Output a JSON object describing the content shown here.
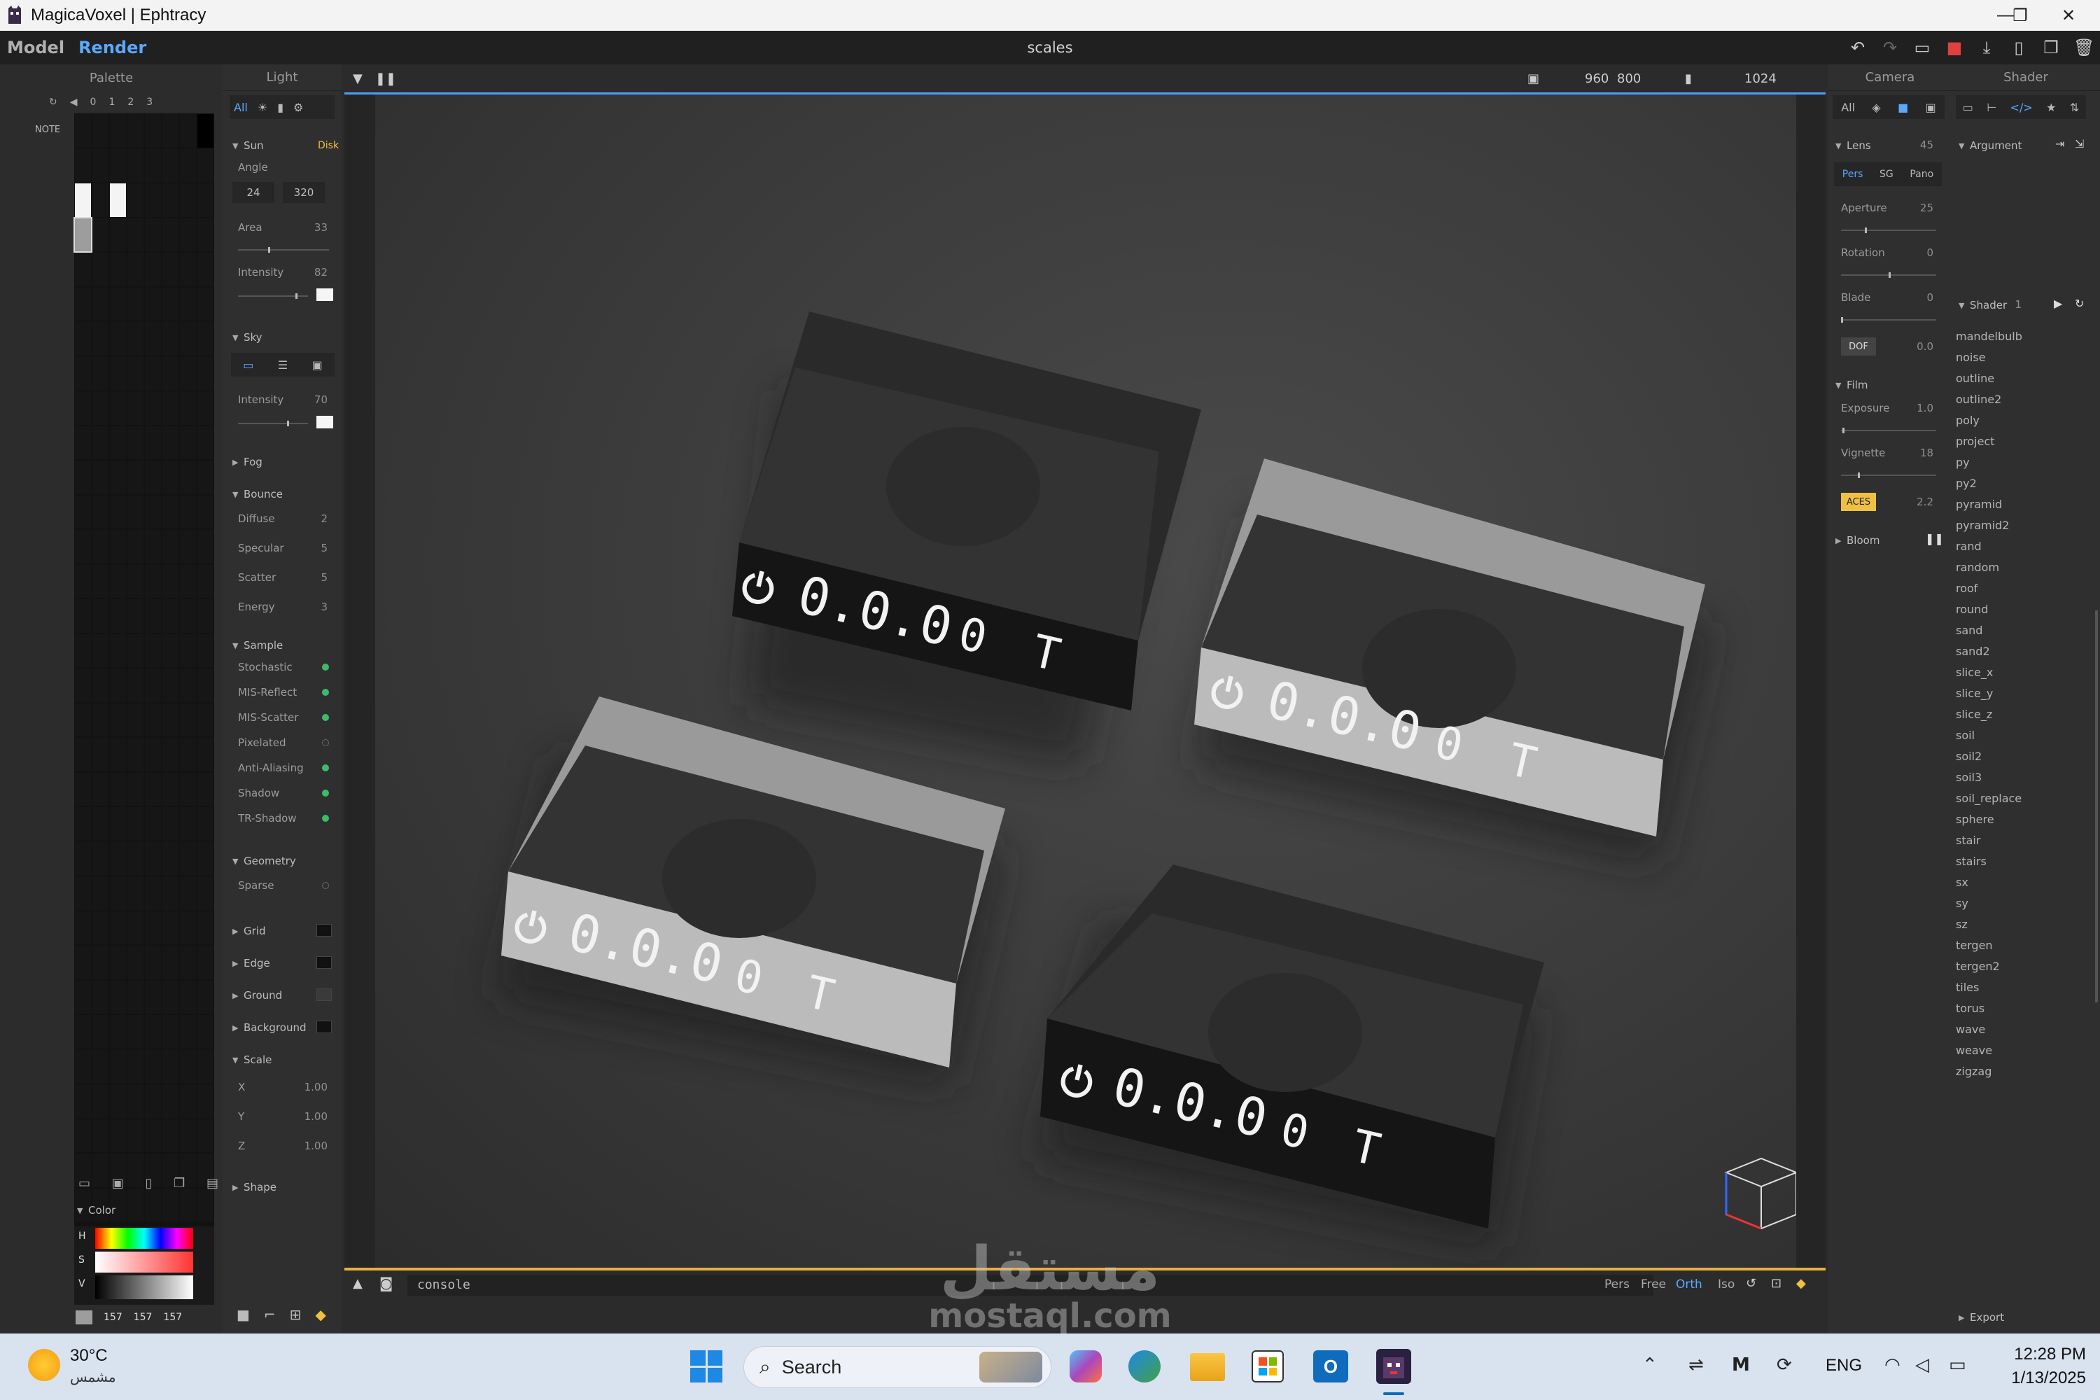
{
  "window": {
    "title": "MagicaVoxel | Ephtracy",
    "min": "—",
    "max": "❐",
    "close": "✕"
  },
  "menu": {
    "model": "Model",
    "render": "Render",
    "document": "scales"
  },
  "palette": {
    "title": "Palette",
    "pages": [
      "0",
      "1",
      "2",
      "3"
    ],
    "note": "NOTE",
    "color_title": "Color",
    "h": "H",
    "s": "S",
    "v": "V",
    "rgb": [
      "157",
      "157",
      "157"
    ]
  },
  "light": {
    "title": "Light",
    "all": "All",
    "sun": "Sun",
    "disk": "Disk",
    "angle": "Angle",
    "angle_a": "24",
    "angle_b": "320",
    "area": "Area",
    "area_v": "33",
    "intensity": "Intensity",
    "intensity_v": "82",
    "sky": "Sky",
    "sky_intensity": "Intensity",
    "sky_intensity_v": "70",
    "fog": "Fog",
    "bounce": "Bounce",
    "diffuse": "Diffuse",
    "diffuse_v": "2",
    "specular": "Specular",
    "specular_v": "5",
    "scatter": "Scatter",
    "scatter_v": "5",
    "energy": "Energy",
    "energy_v": "3",
    "sample": "Sample",
    "samples": [
      "Stochastic",
      "MIS-Reflect",
      "MIS-Scatter",
      "Pixelated",
      "Anti-Aliasing",
      "Shadow",
      "TR-Shadow"
    ],
    "sample_on": [
      true,
      true,
      true,
      false,
      true,
      true,
      true
    ],
    "geometry": "Geometry",
    "sparse": "Sparse",
    "grid": "Grid",
    "edge": "Edge",
    "ground": "Ground",
    "background": "Background",
    "scale": "Scale",
    "x": "X",
    "y": "Y",
    "z": "Z",
    "xv": "1.00",
    "yv": "1.00",
    "zv": "1.00",
    "shape": "Shape"
  },
  "viewport": {
    "width": "960",
    "height": "800",
    "samples": "1024",
    "console": "console",
    "modes": [
      "Pers",
      "Free",
      "Orth",
      "Iso"
    ],
    "active_mode": "Orth",
    "display_text": "0.0.0",
    "unit_zero": "0",
    "unit_t": "T"
  },
  "camera": {
    "title": "Camera",
    "all": "All",
    "lens": "Lens",
    "lens_v": "45",
    "pers": "Pers",
    "sg": "SG",
    "pano": "Pano",
    "aperture": "Aperture",
    "aperture_v": "25",
    "rotation": "Rotation",
    "rotation_v": "0",
    "blade": "Blade",
    "blade_v": "0",
    "dof": "DOF",
    "dof_v": "0.0",
    "film": "Film",
    "exposure": "Exposure",
    "exposure_v": "1.0",
    "vignette": "Vignette",
    "vignette_v": "18",
    "aces": "ACES",
    "aces_v": "2.2",
    "bloom": "Bloom"
  },
  "shader": {
    "title": "Shader",
    "argument": "Argument",
    "shader_label": "Shader",
    "shader_v": "1",
    "items": [
      "mandelbulb",
      "noise",
      "outline",
      "outline2",
      "poly",
      "project",
      "py",
      "py2",
      "pyramid",
      "pyramid2",
      "rand",
      "random",
      "roof",
      "round",
      "sand",
      "sand2",
      "slice_x",
      "slice_y",
      "slice_z",
      "soil",
      "soil2",
      "soil3",
      "soil_replace",
      "sphere",
      "stair",
      "stairs",
      "sx",
      "sy",
      "sz",
      "tergen",
      "tergen2",
      "tiles",
      "torus",
      "wave",
      "weave",
      "zigzag"
    ],
    "export": "Export"
  },
  "watermark": {
    "arabic": "مستقل",
    "latin": "mostaql.com"
  },
  "taskbar": {
    "temp": "30°C",
    "weather": "مشمس",
    "search": "Search",
    "lang": "ENG",
    "time": "12:28 PM",
    "date": "1/13/2025"
  }
}
